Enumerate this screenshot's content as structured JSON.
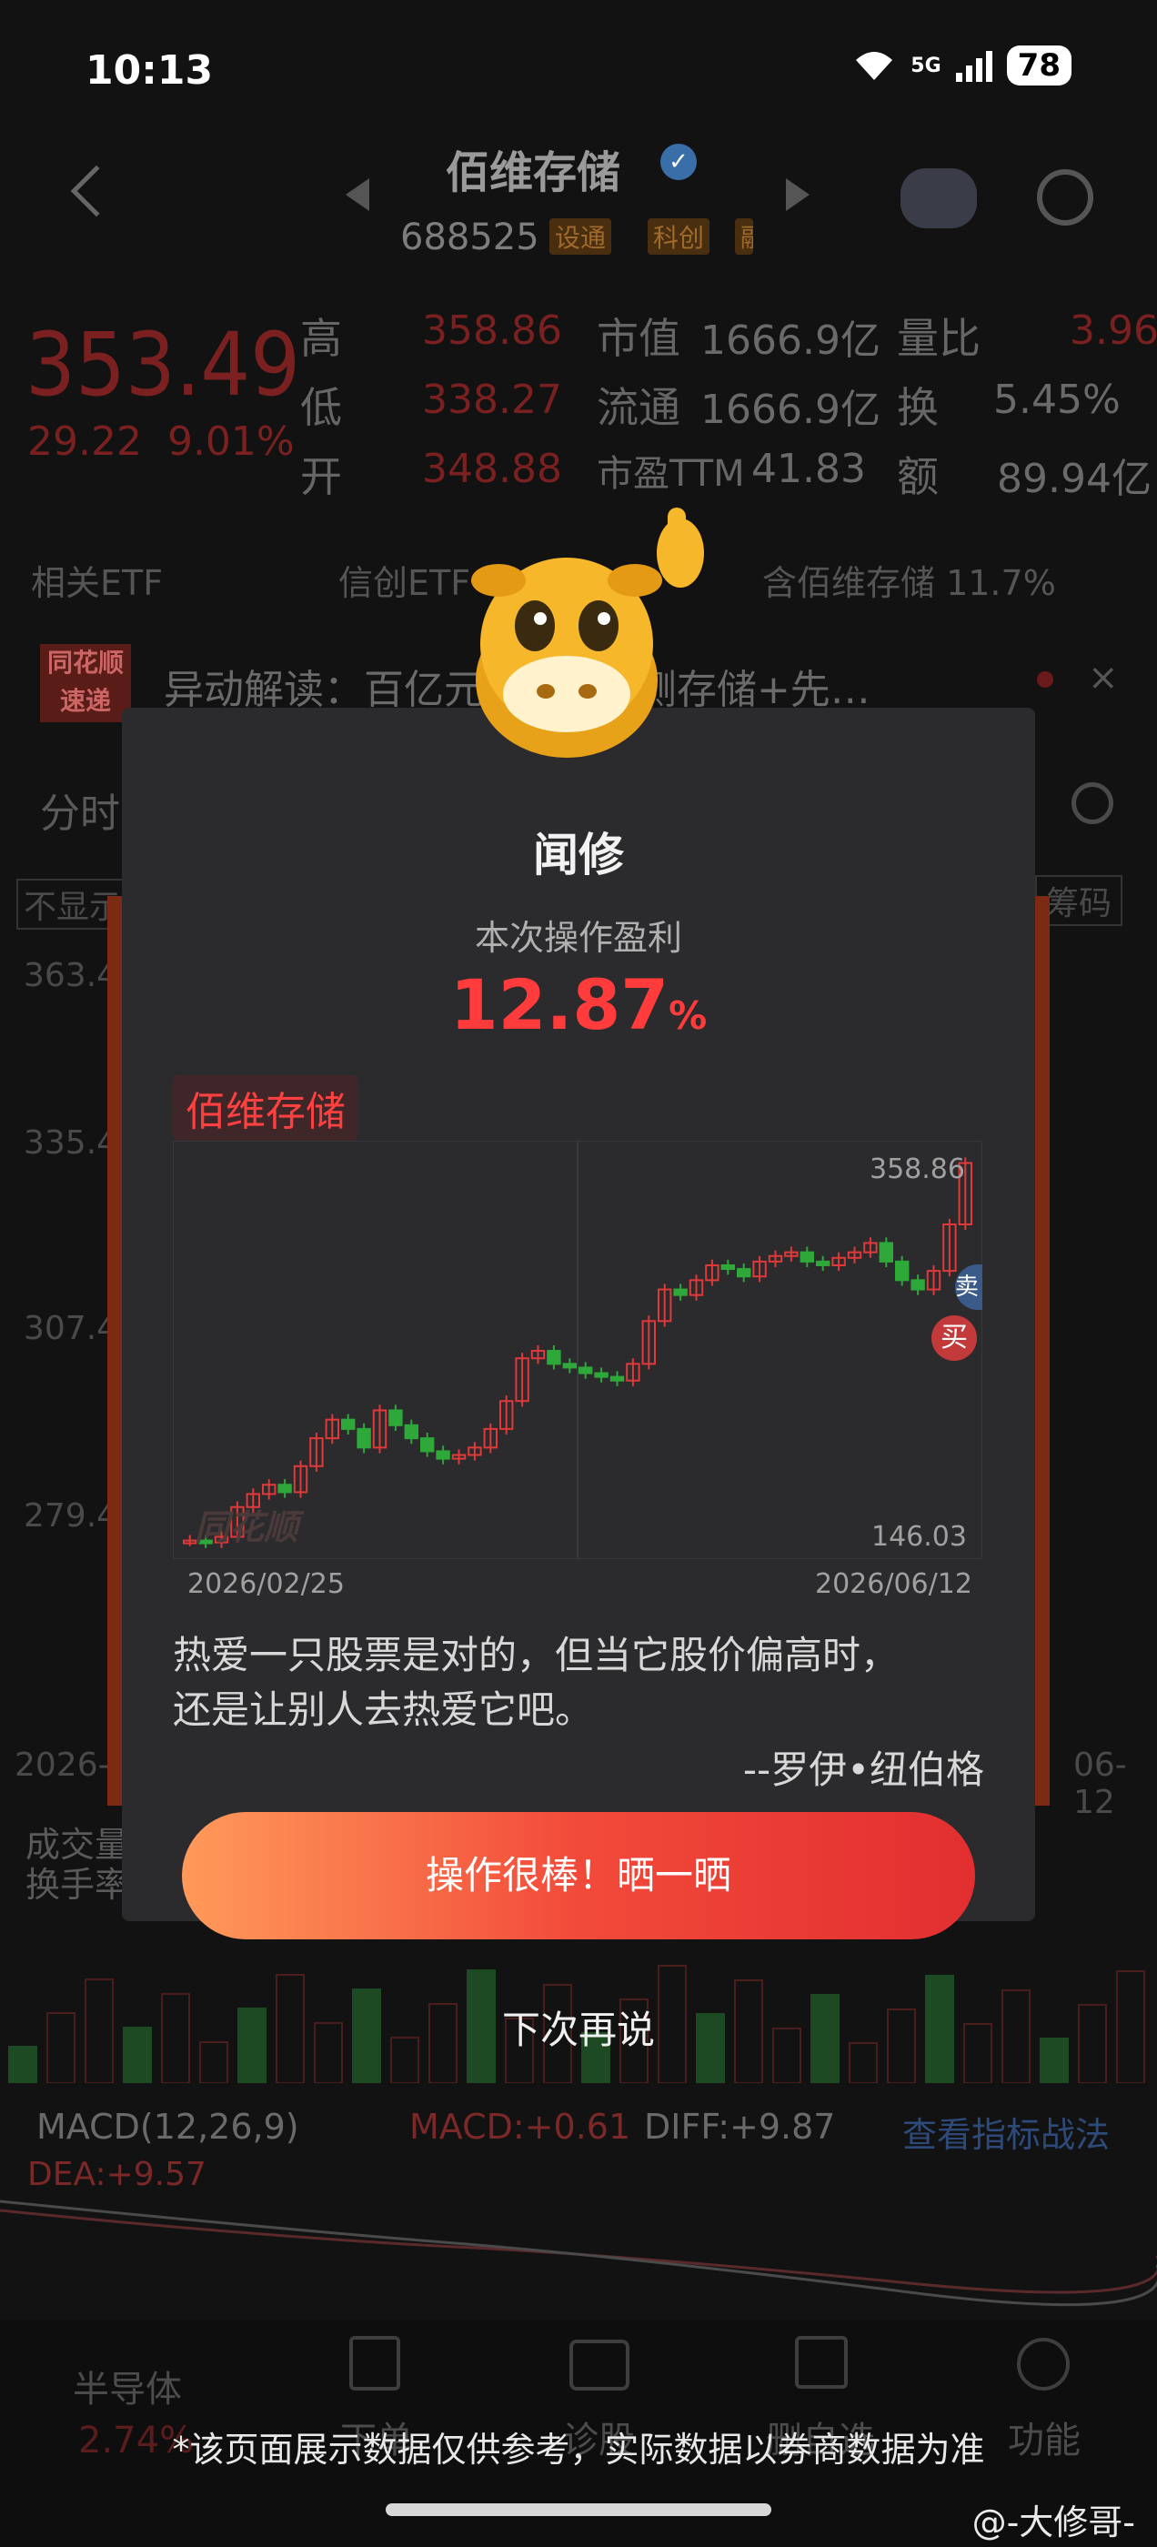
{
  "status_bar": {
    "time": "10:13",
    "network": "5G",
    "battery": "78"
  },
  "header": {
    "stock_name": "佰维存储",
    "stock_code": "688525",
    "tags": [
      "设通",
      "科创",
      "融"
    ]
  },
  "quote": {
    "price": "353.49",
    "change": "29.22",
    "change_pct": "9.01%",
    "rows": [
      {
        "l1": "高",
        "v1": "358.86",
        "l2": "市值",
        "v2": "1666.9亿",
        "l3": "量比",
        "v3": "3.96"
      },
      {
        "l1": "低",
        "v1": "338.27",
        "l2": "流通",
        "v2": "1666.9亿",
        "l3": "换",
        "v3": "5.45%"
      },
      {
        "l1": "开",
        "v1": "348.88",
        "l2": "市盈TTM",
        "v2": "41.83",
        "l3": "额",
        "v3": "89.94亿"
      }
    ]
  },
  "etf_row": {
    "related_etf": "相关ETF",
    "etf": "信创ETF",
    "holding": "含佰维存储 11.7%"
  },
  "news": {
    "logo_line1": "同花顺",
    "logo_line2": "速递",
    "text": "异动解读：百亿元…+AI端侧存储+先…"
  },
  "bg_tabs": {
    "fenshi": "分时",
    "buxian": "不显示",
    "chouma": "筹码"
  },
  "bg_axis": [
    "363.4",
    "335.4",
    "307.4",
    "279.4"
  ],
  "bg_dates": [
    "2026-",
    "06-12"
  ],
  "bg_volume": {
    "line1": "成交量",
    "line2": "换手率"
  },
  "modal": {
    "user": "闻修",
    "subtitle": "本次操作盈利",
    "profit": "12.87",
    "profit_unit": "%",
    "stock_tag": "佰维存储",
    "chart_high": "358.86",
    "chart_low": "146.03",
    "date_start": "2026/02/25",
    "date_end": "2026/06/12",
    "watermark": "同花顺",
    "buy_label": "买",
    "sell_label": "卖",
    "quote_line1": "热爱一只股票是对的，但当它股价偏高时，",
    "quote_line2": "还是让别人去热爱它吧。",
    "author": "--罗伊•纽伯格",
    "share_button": "操作很棒！晒一晒",
    "later": "下次再说"
  },
  "chart_data": {
    "type": "candlestick",
    "x_range": [
      "2026/02/25",
      "2026/06/12"
    ],
    "y_labels": {
      "high": 358.86,
      "low": 146.03
    },
    "trades": [
      {
        "type": "buy",
        "label": "买"
      },
      {
        "type": "sell",
        "label": "卖"
      }
    ],
    "closes_approx": [
      150,
      149,
      152,
      168,
      175,
      180,
      176,
      190,
      205,
      215,
      210,
      200,
      220,
      212,
      205,
      198,
      194,
      196,
      200,
      210,
      225,
      248,
      252,
      245,
      243,
      240,
      238,
      236,
      245,
      268,
      285,
      282,
      290,
      298,
      296,
      292,
      300,
      303,
      305,
      300,
      298,
      302,
      305,
      310,
      300,
      290,
      285,
      295,
      320,
      353
    ]
  },
  "macd": {
    "label": "MACD(12,26,9)",
    "macd": "MACD:+0.61",
    "diff": "DIFF:+9.87",
    "dea": "DEA:+9.57",
    "link": "查看指标战法"
  },
  "nav": {
    "item1": "半导体",
    "item1_pct": "2.74%",
    "item2": "下单",
    "item3": "诊股",
    "item4": "删自选",
    "item5": "功能"
  },
  "disclaimer": "*该页面展示数据仅供参考，实际数据以券商数据为准",
  "weibo": "@-大修哥-"
}
